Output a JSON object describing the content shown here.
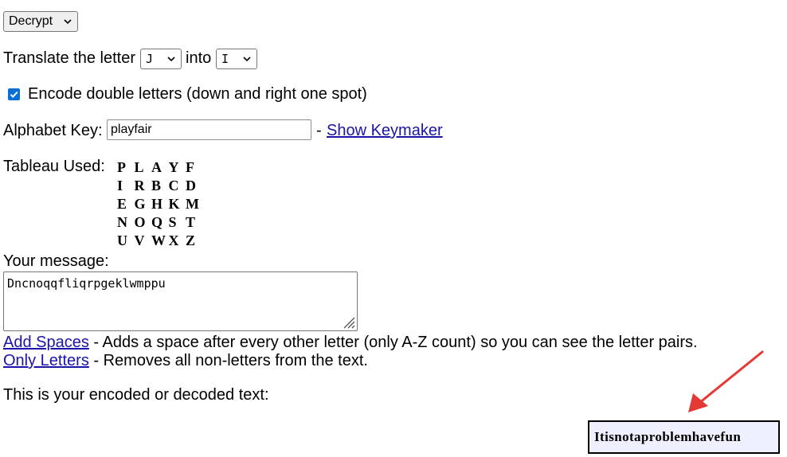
{
  "mode": {
    "selected": "Decrypt"
  },
  "translate": {
    "prefix": "Translate the letter",
    "from_letter": "J",
    "middle": "into",
    "to_letter": "I"
  },
  "double_letters": {
    "checked": true,
    "label": "Encode double letters (down and right one spot)"
  },
  "alphabet_key": {
    "label": "Alphabet Key:",
    "value": "playfair",
    "separator": "-",
    "keymaker_link": "Show Keymaker"
  },
  "tableau": {
    "label": "Tableau Used:",
    "rows": [
      [
        "P",
        "L",
        "A",
        "Y",
        "F"
      ],
      [
        "I",
        "R",
        "B",
        "C",
        "D"
      ],
      [
        "E",
        "G",
        "H",
        "K",
        "M"
      ],
      [
        "N",
        "O",
        "Q",
        "S",
        "T"
      ],
      [
        "U",
        "V",
        "W",
        "X",
        "Z"
      ]
    ]
  },
  "message": {
    "label": "Your message:",
    "value": "Dncnoqqfliqrpgeklwmppu"
  },
  "tools": {
    "add_spaces_link": "Add Spaces",
    "add_spaces_desc": " - Adds a space after every other letter (only A-Z count) so you can see the letter pairs.",
    "only_letters_link": "Only Letters",
    "only_letters_desc": " - Removes all non-letters from the text."
  },
  "result": {
    "label": "This is your encoded or decoded text:",
    "value": "Itisnotaproblemhavefun"
  },
  "annotation": {
    "arrow_color": "#e53935"
  }
}
